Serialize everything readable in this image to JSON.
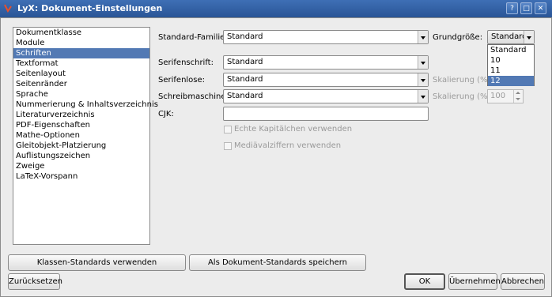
{
  "window": {
    "title": "LyX: Dokument-Einstellungen",
    "help": "?",
    "maximize": "□",
    "close": "✕"
  },
  "sidebar": {
    "items": [
      {
        "label": "Dokumentklasse"
      },
      {
        "label": "Module"
      },
      {
        "label": "Schriften",
        "selected": true
      },
      {
        "label": "Textformat"
      },
      {
        "label": "Seitenlayout"
      },
      {
        "label": "Seitenränder"
      },
      {
        "label": "Sprache"
      },
      {
        "label": "Nummerierung & Inhaltsverzeichnis"
      },
      {
        "label": "Literaturverzeichnis"
      },
      {
        "label": "PDF-Eigenschaften"
      },
      {
        "label": "Mathe-Optionen"
      },
      {
        "label": "Gleitobjekt-Platzierung"
      },
      {
        "label": "Auflistungszeichen"
      },
      {
        "label": "Zweige"
      },
      {
        "label": "LaTeX-Vorspann"
      }
    ]
  },
  "fonts": {
    "family_label": "Standard-Familie:",
    "family_value": "Standard",
    "size_label": "Grundgröße:",
    "size_value": "Standard",
    "size_options": [
      "Standard",
      "10",
      "11",
      "12"
    ],
    "roman_label": "Serifenschrift:",
    "roman_value": "Standard",
    "sans_label": "Serifenlose:",
    "sans_value": "Standard",
    "sans_scale_label": "Skalierung (%):",
    "typewriter_label": "Schreibmaschine:",
    "typewriter_value": "Standard",
    "tt_scale_label": "Skalierung (%):",
    "tt_scale_value": "100",
    "cjk_label": "CJK:",
    "cjk_value": "",
    "smallcaps_label": "Echte Kapitälchen verwenden",
    "oldstyle_label": "Mediävalziffern verwenden"
  },
  "buttons": {
    "class_defaults": "Klassen-Standards verwenden",
    "save_defaults": "Als Dokument-Standards speichern",
    "reset": "Zurücksetzen",
    "ok": "OK",
    "apply": "Übernehmen",
    "cancel": "Abbrechen"
  }
}
